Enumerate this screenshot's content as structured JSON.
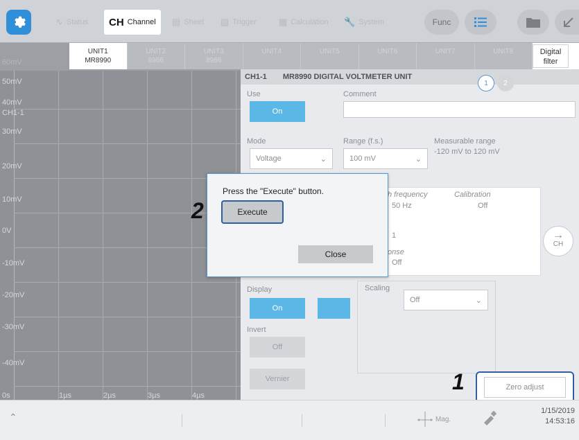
{
  "toolbar": {
    "tabs": [
      {
        "icon": "waveform-icon",
        "label": "Status"
      },
      {
        "big": "CH",
        "label": "Channel"
      },
      {
        "label": "Sheet"
      },
      {
        "label": "Trigger"
      },
      {
        "label": "Calculation"
      },
      {
        "label": "System"
      }
    ],
    "func_label": "Func"
  },
  "units": [
    {
      "name": "UNIT1",
      "model": "MR8990"
    },
    {
      "name": "UNIT2",
      "model": "8966"
    },
    {
      "name": "UNIT3",
      "model": "8966"
    },
    {
      "name": "UNIT4",
      "model": ""
    },
    {
      "name": "UNIT5",
      "model": ""
    },
    {
      "name": "UNIT6",
      "model": ""
    },
    {
      "name": "UNIT7",
      "model": ""
    },
    {
      "name": "UNIT8",
      "model": ""
    }
  ],
  "digital_filter": "Digital filter",
  "waveform": {
    "top_label": "60mV",
    "y_labels": [
      "50mV",
      "40mV",
      "30mV",
      "20mV",
      "10mV",
      "0V",
      "-10mV",
      "-20mV",
      "-30mV",
      "-40mV"
    ],
    "channel": "CH1-1",
    "x_labels": [
      "0s",
      "1µs",
      "2µs",
      "3µs",
      "4µs"
    ]
  },
  "panel": {
    "channel_id": "CH1-1",
    "unit_title": "MR8990 DIGITAL VOLTMETER UNIT",
    "page_current": "1",
    "page_other": "2",
    "use_label": "Use",
    "use_value": "On",
    "comment_label": "Comment",
    "mode_label": "Mode",
    "mode_value": "Voltage",
    "range_label": "Range (f.s.)",
    "range_value": "100 mV",
    "measurable_label": "Measurable range",
    "measurable_value": "-120 mV to 120 mV",
    "freq_label": "h frequency",
    "freq_value": "50 Hz",
    "calibration_label": "Calibration",
    "calibration_value": "Off",
    "nplc_value": "1",
    "response_label": "onse",
    "response_value": "Off",
    "display_label": "Display",
    "display_value": "On",
    "scaling_label": "Scaling",
    "scaling_value": "Off",
    "invert_label": "Invert",
    "invert_value": "Off",
    "vernier_label": "Vernier",
    "zero_adjust": "Zero adjust",
    "next_ch": "CH"
  },
  "dialog": {
    "message": "Press the \"Execute\" button.",
    "execute": "Execute",
    "close": "Close"
  },
  "callouts": {
    "one": "1",
    "two": "2"
  },
  "status": {
    "mag_label": "Mag.",
    "date": "1/15/2019",
    "time": "14:53:16"
  }
}
